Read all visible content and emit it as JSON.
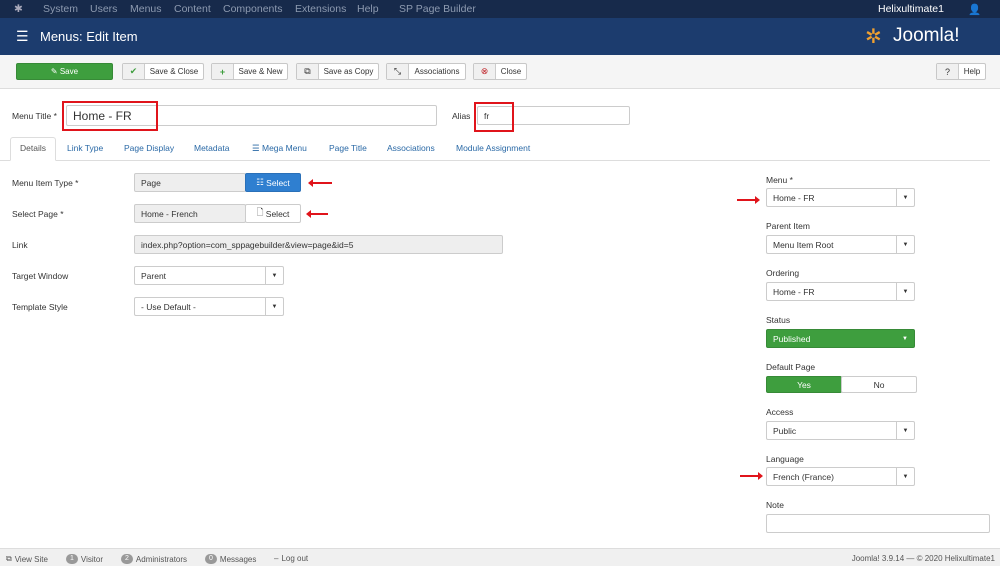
{
  "topnav": {
    "items": [
      "System",
      "Users",
      "Menus",
      "Content",
      "Components",
      "Extensions",
      "Help",
      "SP Page Builder"
    ],
    "user": "Helixultimate1"
  },
  "header": {
    "title": "Menus: Edit Item",
    "logo": "Joomla!"
  },
  "toolbar": {
    "save": "Save",
    "save_close": "Save & Close",
    "save_new": "Save & New",
    "save_copy": "Save as Copy",
    "associations": "Associations",
    "close": "Close",
    "help": "Help"
  },
  "form": {
    "menu_title_label": "Menu Title *",
    "menu_title": "Home - FR",
    "alias_label": "Alias",
    "alias": "fr"
  },
  "tabs": [
    "Details",
    "Link Type",
    "Page Display",
    "Metadata",
    "Mega Menu",
    "Page Title",
    "Associations",
    "Module Assignment"
  ],
  "details": {
    "menu_item_type_label": "Menu Item Type *",
    "menu_item_type": "Page",
    "select_label": "Select",
    "select_page_label": "Select Page *",
    "select_page": "Home - French",
    "link_label": "Link",
    "link": "index.php?option=com_sppagebuilder&view=page&id=5",
    "target_label": "Target Window",
    "target": "Parent",
    "template_label": "Template Style",
    "template": "- Use Default -"
  },
  "side": {
    "menu_label": "Menu *",
    "menu": "Home - FR",
    "parent_label": "Parent Item",
    "parent": "Menu Item Root",
    "ordering_label": "Ordering",
    "ordering": "Home - FR",
    "status_label": "Status",
    "status": "Published",
    "default_label": "Default Page",
    "yes": "Yes",
    "no": "No",
    "access_label": "Access",
    "access": "Public",
    "language_label": "Language",
    "language": "French (France)",
    "note_label": "Note",
    "note": ""
  },
  "footer": {
    "view_site": "View Site",
    "visitors": "1",
    "visitor_label": "Visitor",
    "admins": "2",
    "admin_label": "Administrators",
    "messages": "0",
    "messages_label": "Messages",
    "logout": "Log out",
    "version": "Joomla! 3.9.14 — © 2020 Helixultimate1"
  },
  "colors": {
    "nav": "#172a4b",
    "header": "#1c3c6e",
    "save": "#3e9e3e",
    "select": "#2f7fd0",
    "annotation": "#e0141b"
  }
}
